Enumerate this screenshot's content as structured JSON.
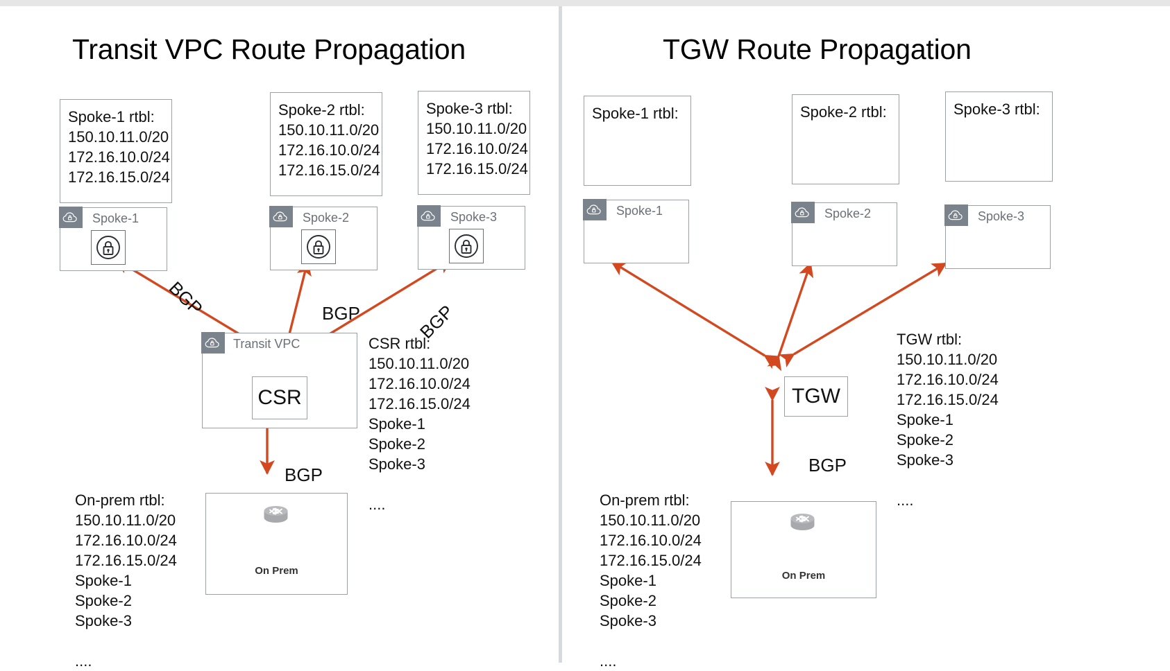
{
  "colors": {
    "arrow": "#d4481f",
    "box_border": "#9aa0a6",
    "vpc_tab": "#7a828c",
    "vpc_label": "#6b7077",
    "divider": "#d6d9de",
    "text": "#111111"
  },
  "left_panel": {
    "title": "Transit VPC Route Propagation",
    "spoke_rtbls": [
      {
        "name": "spoke-1-rtbl",
        "text": "Spoke-1 rtbl:\n150.10.11.0/20\n172.16.10.0/24\n172.16.15.0/24\n\n...."
      },
      {
        "name": "spoke-2-rtbl",
        "text": "Spoke-2 rtbl:\n150.10.11.0/20\n172.16.10.0/24\n172.16.15.0/24\n\n...."
      },
      {
        "name": "spoke-3-rtbl",
        "text": "Spoke-3 rtbl:\n150.10.11.0/20\n172.16.10.0/24\n172.16.15.0/24\n\n...."
      }
    ],
    "spokes": [
      {
        "label": "Spoke-1",
        "icon": "vpc-cloud-lock-icon",
        "inner_icon": "vpn-lock-icon"
      },
      {
        "label": "Spoke-2",
        "icon": "vpc-cloud-lock-icon",
        "inner_icon": "vpn-lock-icon"
      },
      {
        "label": "Spoke-3",
        "icon": "vpc-cloud-lock-icon",
        "inner_icon": "vpn-lock-icon"
      }
    ],
    "transit_vpc": {
      "label": "Transit VPC",
      "icon": "vpc-cloud-lock-icon"
    },
    "router_node": "CSR",
    "router_rtbl": "CSR  rtbl:\n150.10.11.0/20\n172.16.10.0/24\n172.16.15.0/24\nSpoke-1\nSpoke-2\nSpoke-3\n\n....",
    "onprem_rtbl": "On-prem rtbl:\n150.10.11.0/20\n172.16.10.0/24\n172.16.15.0/24\nSpoke-1\nSpoke-2\nSpoke-3\n\n....",
    "onprem": {
      "label": "On Prem",
      "icon": "router-icon"
    },
    "bgp_labels": [
      "BGP",
      "BGP",
      "BGP",
      "BGP"
    ]
  },
  "right_panel": {
    "title": "TGW Route Propagation",
    "spoke_rtbls": [
      {
        "name": "spoke-1-rtbl",
        "text": "Spoke-1 rtbl:"
      },
      {
        "name": "spoke-2-rtbl",
        "text": "Spoke-2 rtbl:"
      },
      {
        "name": "spoke-3-rtbl",
        "text": "Spoke-3 rtbl:"
      }
    ],
    "spokes": [
      {
        "label": "Spoke-1",
        "icon": "vpc-cloud-lock-icon"
      },
      {
        "label": "Spoke-2",
        "icon": "vpc-cloud-lock-icon"
      },
      {
        "label": "Spoke-3",
        "icon": "vpc-cloud-lock-icon"
      }
    ],
    "router_node": "TGW",
    "router_rtbl": "TGW rtbl:\n150.10.11.0/20\n172.16.10.0/24\n172.16.15.0/24\nSpoke-1\nSpoke-2\nSpoke-3\n\n....",
    "onprem_rtbl": "On-prem rtbl:\n150.10.11.0/20\n172.16.10.0/24\n172.16.15.0/24\nSpoke-1\nSpoke-2\nSpoke-3\n\n....",
    "onprem": {
      "label": "On Prem",
      "icon": "router-icon"
    },
    "bgp_labels": [
      "BGP"
    ]
  }
}
